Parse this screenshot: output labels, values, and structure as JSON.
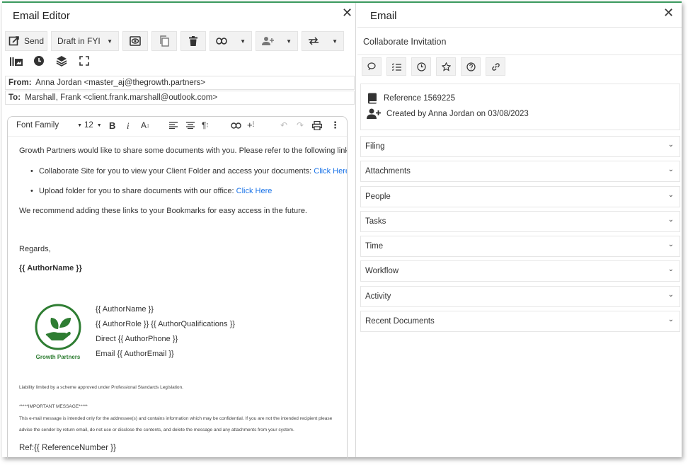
{
  "left": {
    "title": "Email Editor",
    "close": "✕",
    "send_label": "Send",
    "draft_label": "Draft in FYI",
    "from_label": "From:",
    "from_value": "Anna Jordan <master_aj@thegrowth.partners>",
    "to_label": "To:",
    "to_value": "Marshall, Frank <client.frank.marshall@outlook.com>",
    "editor": {
      "font_family": "Font Family",
      "font_size": "12",
      "intro": "Growth Partners would like to share some documents with you. Please refer to the following links:",
      "bullet1": "Collaborate Site for you to view your Client Folder and access your documents:",
      "bullet1_link": "Click Here",
      "bullet2": "Upload folder for you to share documents with our office:",
      "bullet2_link": "Click Here",
      "recommend": "We recommend adding these links to your Bookmarks for easy access in the future.",
      "regards": "Regards,",
      "author": "{{ AuthorName }}",
      "logo_text": "Growth Partners",
      "sig_name": "{{ AuthorName }}",
      "sig_role": "{{ AuthorRole }} {{ AuthorQualifications }}",
      "sig_phone": "Direct {{ AuthorPhone }}",
      "sig_email": "Email {{ AuthorEmail }}",
      "liability": "Liability limited by a scheme approved under Professional Standards Legislation.",
      "important": "*****IMPORTANT MESSAGE*****",
      "disclaimer1": "This e-mail message is intended only for the addressee(s) and contains information which may be confidential.  If you are not the intended recipient please",
      "disclaimer2": "advise the sender by return email, do not use or disclose the contents, and delete the message and any attachments from your system.",
      "ref": "Ref:{{ ReferenceNumber }}"
    }
  },
  "right": {
    "title": "Email",
    "close": "✕",
    "subject": "Collaborate Invitation",
    "reference": "Reference 1569225",
    "created": "Created by Anna Jordan on 03/08/2023",
    "sections": [
      "Filing",
      "Attachments",
      "People",
      "Tasks",
      "Time",
      "Workflow",
      "Activity",
      "Recent Documents"
    ]
  },
  "colors": {
    "accent": "#3c9a5f",
    "link": "#1a73e8",
    "logo_green": "#2e7d32"
  }
}
